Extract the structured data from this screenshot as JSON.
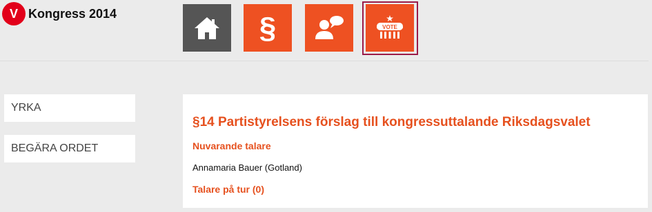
{
  "header": {
    "logo_mark": "V",
    "app_title": "Kongress 2014"
  },
  "nav": {
    "items": [
      {
        "name": "home",
        "icon": "home-icon",
        "color": "#555555"
      },
      {
        "name": "section",
        "icon": "section-icon",
        "glyph": "§",
        "color": "#ee5122"
      },
      {
        "name": "speaker",
        "icon": "speaker-icon",
        "color": "#ee5122"
      },
      {
        "name": "vote",
        "icon": "vote-icon",
        "badge_text": "VOTE",
        "color": "#ee5122",
        "selected": true
      }
    ],
    "selected_border_color": "#9b1b48"
  },
  "sidebar": {
    "items": [
      {
        "label": "YRKA"
      },
      {
        "label": "BEGÄRA ORDET"
      }
    ]
  },
  "main": {
    "title": "§14 Partistyrelsens förslag till kongressuttalande Riksdagsvalet",
    "current_speaker_label": "Nuvarande talare",
    "current_speaker": "Annamaria Bauer (Gotland)",
    "queue_label": "Talare på tur (0)"
  },
  "colors": {
    "accent": "#e6511f",
    "logo_red": "#e2001a",
    "background": "#ebebeb"
  }
}
